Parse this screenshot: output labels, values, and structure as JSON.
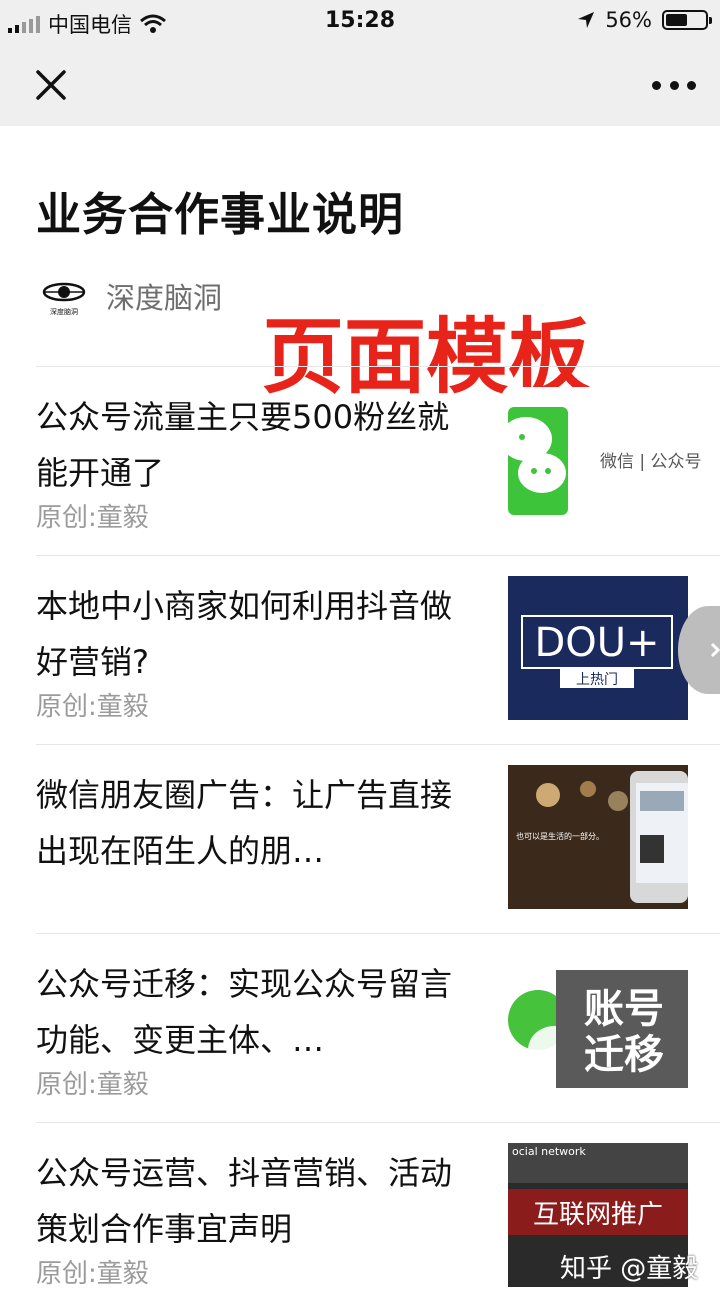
{
  "status": {
    "carrier": "中国电信",
    "time": "15:28",
    "battery": "56%",
    "battery_level": 0.56
  },
  "icons": {
    "close": "close-icon",
    "more": "more-icon",
    "wifi": "wifi-icon",
    "location": "location-arrow-icon"
  },
  "article": {
    "title": "业务合作事业说明",
    "author": "深度脑洞",
    "logo_text": "深度脑洞"
  },
  "overlay": {
    "watermark": "页面模板",
    "watermark_color": "#e8241a",
    "corner_watermark": "知乎 @童毅"
  },
  "items": [
    {
      "title": "公众号流量主只要500粉丝就能开通了",
      "meta": "原创:童毅",
      "thumb_label": "微信 | 公众号"
    },
    {
      "title": "本地中小商家如何利用抖音做好营销?",
      "meta": "原创:童毅",
      "thumb_main": "DOU+",
      "thumb_sub": "上热门"
    },
    {
      "title": "微信朋友圈广告：让广告直接出现在陌生人的朋…",
      "meta": "",
      "thumb_caption": "也可以是生活的一部分。"
    },
    {
      "title": "公众号迁移：实现公众号留言功能、变更主体、…",
      "meta": "原创:童毅",
      "thumb_line1": "账号",
      "thumb_line2": "迁移"
    },
    {
      "title": "公众号运营、抖音营销、活动策划合作事宜声明",
      "meta": "原创:童毅",
      "thumb_top": "ocial network",
      "thumb_main": "互联网推广"
    }
  ]
}
